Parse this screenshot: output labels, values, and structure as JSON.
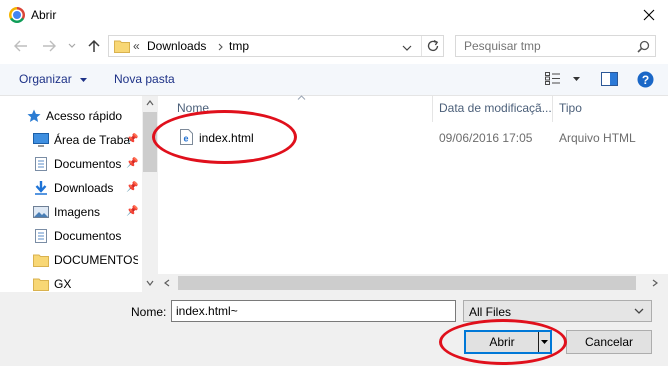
{
  "window": {
    "title": "Abrir"
  },
  "address_bar": {
    "overflow": "«",
    "segments": [
      "Downloads",
      "tmp"
    ]
  },
  "search": {
    "placeholder": "Pesquisar tmp"
  },
  "toolbar": {
    "organize_label": "Organizar",
    "new_folder_label": "Nova pasta"
  },
  "nav_pane": {
    "quick_access": "Acesso rápido",
    "items": [
      {
        "label": "Área de Traba",
        "icon": "desktop-icon",
        "pinned": true
      },
      {
        "label": "Documentos",
        "icon": "documents-icon",
        "pinned": true
      },
      {
        "label": "Downloads",
        "icon": "downloads-icon",
        "pinned": true
      },
      {
        "label": "Imagens",
        "icon": "pictures-icon",
        "pinned": true
      },
      {
        "label": "Documentos",
        "icon": "documents-icon",
        "pinned": false
      },
      {
        "label": "DOCUMENTOS",
        "icon": "folder-icon",
        "pinned": false
      },
      {
        "label": "GX",
        "icon": "folder-icon",
        "pinned": false
      }
    ]
  },
  "file_list": {
    "columns": [
      "Nome",
      "Data de modificaçã...",
      "Tipo"
    ],
    "rows": [
      {
        "name": "index.html",
        "modified": "09/06/2016 17:05",
        "type": "Arquivo HTML"
      }
    ]
  },
  "footer": {
    "name_label": "Nome:",
    "file_name_value": "index.html~",
    "file_type": "All Files",
    "open_label": "Abrir",
    "cancel_label": "Cancelar"
  },
  "colors": {
    "annotation": "#e0101c",
    "focus_blue": "#0078d7",
    "folder_yellow": "#f8d775"
  }
}
